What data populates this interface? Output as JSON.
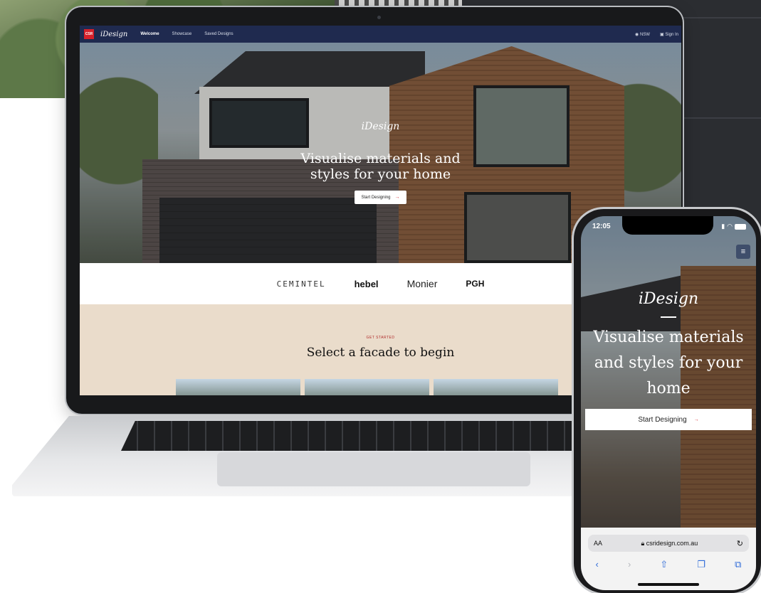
{
  "site_nav": {
    "logo": "CSR",
    "brand": "iDesign",
    "links": [
      "Welcome",
      "Showcase",
      "Saved Designs"
    ],
    "region": "NSW",
    "sign_in": "Sign In"
  },
  "hero": {
    "brand": "iDesign",
    "title": "Visualise materials and styles for your home",
    "button_label": "Start Designing",
    "button_arrow": "→"
  },
  "brands": [
    "CEMINTEL",
    "hebel",
    "Monier",
    "PGH"
  ],
  "facade_section": {
    "eyebrow": "GET STARTED",
    "title": "Select a facade to begin"
  },
  "phone": {
    "status_time": "12:05",
    "brand": "iDesign",
    "title": "Visualise materials and styles for your home",
    "button_label": "Start Designing",
    "button_arrow": "→",
    "browser": {
      "aa": "AA",
      "url": "csridesign.com.au",
      "reload": "↻"
    },
    "menu_icon": "hamburger-icon"
  },
  "colors": {
    "nav_bg": "#1f2a4f",
    "accent_red": "#d6202a",
    "section_beige": "#eadccb"
  }
}
